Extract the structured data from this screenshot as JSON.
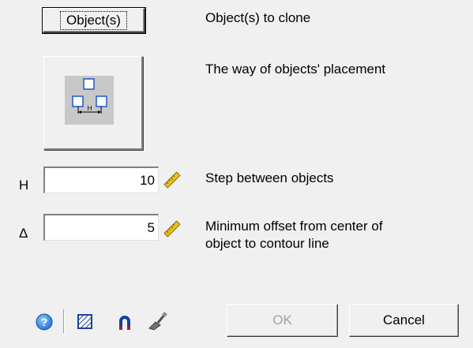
{
  "objects_button": {
    "label": "Object(s)"
  },
  "objects_desc": "Object(s) to clone",
  "placement": {
    "desc": "The way of objects' placement",
    "icon_letter": "H"
  },
  "step": {
    "label": "H",
    "value": "10",
    "desc": "Step between objects"
  },
  "offset": {
    "label": "Δ",
    "value": "5",
    "desc_line1": "Minimum offset from center of",
    "desc_line2": "object to contour line"
  },
  "toolbar": {
    "icons": [
      "help-icon",
      "hatch-settings-icon",
      "snap-magnet-icon",
      "style-brush-icon"
    ]
  },
  "buttons": {
    "ok": "OK",
    "cancel": "Cancel"
  },
  "colors": {
    "background": "#f0f0f0",
    "help_blue": "#1e6fd9",
    "magnet_blue": "#1040a0",
    "magnet_red": "#cc1010",
    "ruler_yellow": "#e8c020"
  }
}
